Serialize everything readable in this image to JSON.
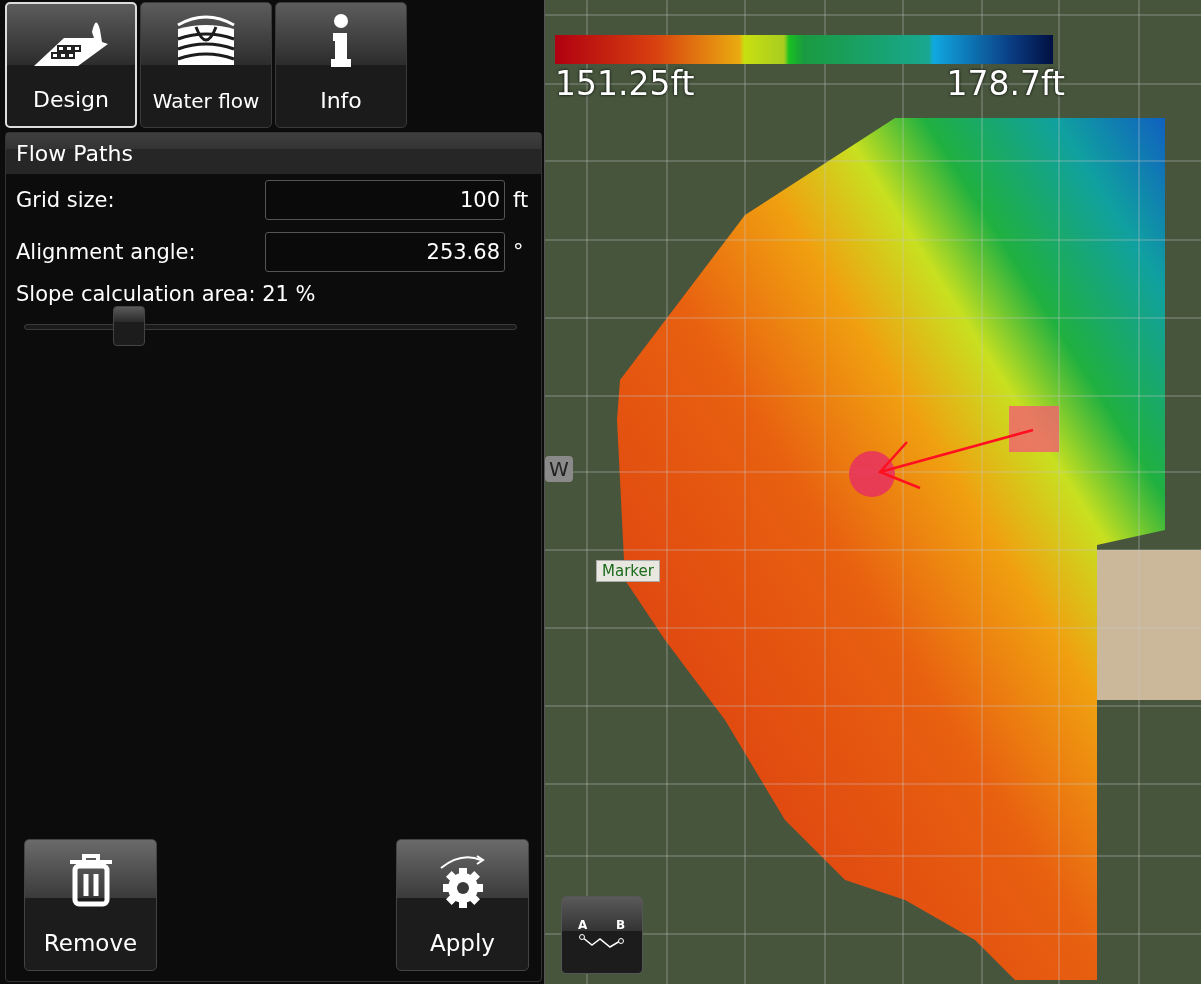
{
  "tabs": [
    {
      "label": "Design",
      "kind": "design",
      "selected": true
    },
    {
      "label": "Water flow",
      "kind": "water",
      "selected": false
    },
    {
      "label": "Info",
      "kind": "info",
      "selected": false
    }
  ],
  "panel": {
    "title": "Flow Paths",
    "fields": [
      {
        "label": "Grid size:",
        "value": "100",
        "unit": "ft"
      },
      {
        "label": "Alignment angle:",
        "value": "253.68",
        "unit": "°"
      }
    ],
    "slider": {
      "label": "Slope calculation area: 21 %",
      "level": 0.21
    }
  },
  "buttons": [
    {
      "label": "Remove",
      "kind": "remove"
    },
    {
      "label": "Apply",
      "kind": "apply"
    }
  ],
  "map": {
    "legend": {
      "min": "151.25ft",
      "max": "178.7ft"
    },
    "compass": "W",
    "marker": "Marker",
    "profile_button": {
      "a": "A",
      "b": "B"
    }
  }
}
